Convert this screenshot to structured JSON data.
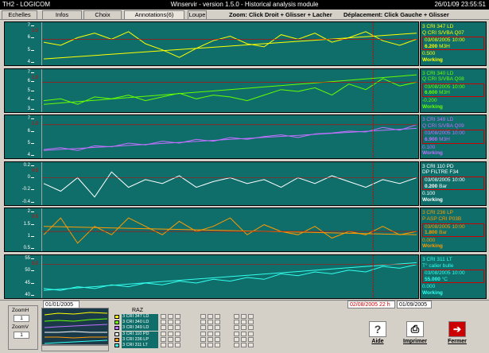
{
  "window": {
    "left_title": "TH2 - LOGICOM",
    "center_title": "Winservir - version 1.5.0 - Historical analysis module",
    "datetime": "26/01/09 23:55:51"
  },
  "tabs": [
    "Echelles",
    "Infos Capteurs",
    "Choix Courbes",
    "Annotations(6)",
    "Loupe"
  ],
  "help": {
    "zoom": "Zoom: Click Droit + Glisser + Lacher",
    "move": "Déplacement: Click Gauche + Glisser"
  },
  "panels": [
    {
      "ticks": [
        "7",
        "6",
        "5",
        "4"
      ],
      "scale": "1.0",
      "color": "#ffff00",
      "series": [
        6.2,
        6.0,
        6.5,
        6.8,
        6.4,
        6.9,
        6.1,
        5.7,
        5.2,
        5.8,
        6.3,
        6.6,
        6.1,
        5.9,
        6.7,
        6.4,
        6.8,
        6.2,
        6.5,
        6.9,
        6.3,
        6.0,
        6.4
      ],
      "trend": [
        5.1,
        6.8
      ],
      "info": {
        "tag": "3 CRI 347 LD",
        "desc": "Q CRI S/VBA Q07",
        "date": "03/08/2005 10:00",
        "value": "6.200",
        "unit": "M3H",
        "extra": "0.500",
        "status": "Working"
      },
      "info_color": "#ffff00"
    },
    {
      "ticks": [
        "7",
        "6",
        "5",
        "4",
        "3"
      ],
      "scale": "1.0",
      "color": "#66ff00",
      "series": [
        5.0,
        5.1,
        4.8,
        5.2,
        5.1,
        5.3,
        5.0,
        5.2,
        5.4,
        5.1,
        5.3,
        5.2,
        5.0,
        5.3,
        5.6,
        5.5,
        5.7,
        5.3,
        5.9,
        5.6,
        6.2,
        5.8,
        6.0
      ],
      "trend": [
        4.8,
        6.4
      ],
      "info": {
        "tag": "3 CRI 340 LD",
        "desc": "Q CRI S/VBA Q08",
        "date": "03/08/2005 10:00",
        "value": "6.600",
        "unit": "M3H",
        "extra": "-0.200",
        "status": "Working"
      },
      "info_color": "#66ff00"
    },
    {
      "ticks": [
        "7",
        "6",
        "5",
        "4"
      ],
      "scale": "1.0",
      "color": "#c070ff",
      "series": [
        4.2,
        4.4,
        4.1,
        4.6,
        4.5,
        4.9,
        4.7,
        5.1,
        4.9,
        5.3,
        5.1,
        5.5,
        5.3,
        5.6,
        5.8,
        5.5,
        5.9,
        6.0,
        6.2,
        6.1,
        6.6,
        6.3,
        6.9
      ],
      "trend": [
        4.1,
        6.5
      ],
      "info": {
        "tag": "3 CRI 349 LD",
        "desc": "Q CRI S/VBA Q09",
        "date": "03/08/2005 10:00",
        "value": "6.900",
        "unit": "M3H",
        "extra": "0.100",
        "status": "Working"
      },
      "info_color": "#c070ff"
    },
    {
      "ticks": [
        "0.2",
        "0",
        "-0.2",
        "-0.4"
      ],
      "scale": "0.5",
      "color": "#ffffff",
      "series": [
        0.12,
        0.08,
        0.15,
        0.05,
        0.18,
        0.1,
        0.14,
        0.12,
        0.16,
        0.1,
        0.13,
        0.15,
        0.12,
        0.14,
        0.1,
        0.15,
        0.12,
        0.16,
        0.13,
        0.1,
        0.14,
        0.12,
        0.15
      ],
      "trend": null,
      "info": {
        "tag": "3 CRI 110 PD",
        "desc": "DP FILTRE F34",
        "date": "03/08/2005 10:00",
        "value": "0.200",
        "unit": "Bar",
        "extra": "0.100",
        "status": "Working"
      },
      "info_color": "#ffffff"
    },
    {
      "ticks": [
        "2",
        "1.5",
        "1",
        "0.5"
      ],
      "scale": "0.5",
      "color": "#ff9a00",
      "series": [
        1.5,
        1.6,
        1.45,
        1.55,
        1.5,
        1.6,
        1.55,
        1.5,
        1.58,
        1.52,
        1.55,
        1.6,
        1.5,
        1.56,
        1.52,
        1.5,
        1.55,
        1.48,
        1.52,
        1.5,
        1.55,
        1.5,
        1.52
      ],
      "trend": [
        1.55,
        1.5
      ],
      "info": {
        "tag": "3 CRI 236 LP",
        "desc": "P ASP CRI P03B",
        "date": "03/08/2005 10:00",
        "value": "1.800",
        "unit": "Bar",
        "extra": "0.000",
        "status": "Working"
      },
      "info_color": "#ff9a00"
    },
    {
      "ticks": [
        "55",
        "50",
        "45",
        "40"
      ],
      "scale": "5.0",
      "color": "#33ffee",
      "series": [
        41,
        40,
        42,
        41,
        43,
        42,
        44,
        43,
        45,
        44,
        46,
        45,
        47,
        46,
        49,
        48,
        50,
        49,
        51,
        50,
        53,
        52,
        54
      ],
      "trend": [
        40,
        55
      ],
      "info": {
        "tag": "3 CRI 311 LT",
        "desc": "T° calier bulle",
        "date": "03/08/2005 10:00",
        "value": "55.000",
        "unit": "°C",
        "extra": "0.000",
        "status": "Working"
      },
      "info_color": "#33ffee"
    }
  ],
  "bottom": {
    "date_start": "01/01/2005",
    "date_cursor": "02/08/2005 22 h",
    "date_end": "01/09/2005",
    "zoomH_label": "ZoomH",
    "zoomH_value": "1",
    "zoomV_label": "ZoomV",
    "zoomV_value": "1",
    "raz": "RAZ",
    "legend": [
      {
        "name": "3 CRI 347 LD",
        "color": "#ffff00"
      },
      {
        "name": "3 CRI 340 LD",
        "color": "#66ff00"
      },
      {
        "name": "3 CRI 349 LD",
        "color": "#c070ff"
      },
      {
        "name": "3 CRI 110 PD",
        "color": "#ffffff"
      },
      {
        "name": "3 CRI 236 LP",
        "color": "#ff9a00"
      },
      {
        "name": "3 CRI 311 LT",
        "color": "#33ffee"
      }
    ],
    "buttons": {
      "aide": "Aide",
      "imprimer": "Imprimer",
      "fermer": "Fermer"
    }
  }
}
